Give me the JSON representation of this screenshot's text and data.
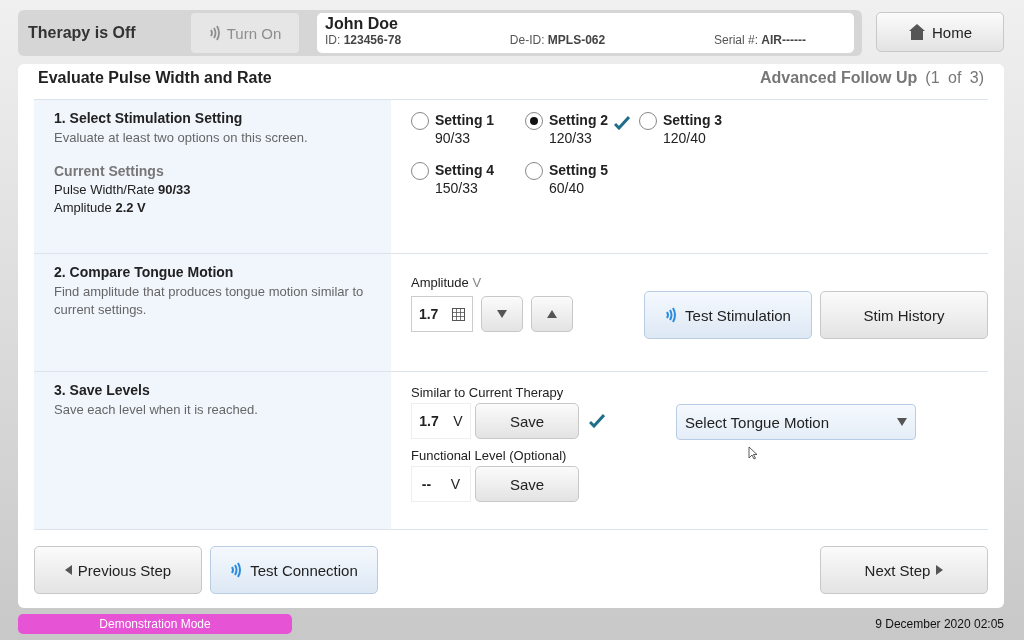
{
  "header": {
    "therapy_status": "Therapy is Off",
    "turn_on": {
      "label": "Turn On",
      "disabled": true
    },
    "patient": {
      "name": "John Doe",
      "id_label": "ID:",
      "id": "123456-78",
      "deid_label": "De-ID:",
      "deid": "MPLS-062",
      "serial_label": "Serial #:",
      "serial": "AIR------"
    },
    "home": "Home"
  },
  "panel": {
    "title": "Evaluate Pulse Width and Rate",
    "subtitle": "Advanced Follow Up",
    "step": "(1 of 3)"
  },
  "section_1": {
    "title": "1. Select Stimulation Setting",
    "hint": "Evaluate at least two options on this screen.",
    "current_heading": "Current Settings",
    "current": [
      {
        "label": "Pulse Width/Rate",
        "value": "90/33"
      },
      {
        "label": "Amplitude",
        "value": "2.2 V"
      }
    ],
    "settings": [
      {
        "label": "Setting 1",
        "value": "90/33",
        "selected": false,
        "evaluated": false
      },
      {
        "label": "Setting 2",
        "value": "120/33",
        "selected": true,
        "evaluated": true
      },
      {
        "label": "Setting 3",
        "value": "120/40",
        "selected": false,
        "evaluated": false
      },
      {
        "label": "Setting 4",
        "value": "150/33",
        "selected": false,
        "evaluated": false
      },
      {
        "label": "Setting 5",
        "value": "60/40",
        "selected": false,
        "evaluated": false
      }
    ]
  },
  "section_2": {
    "title": "2. Compare Tongue Motion",
    "hint": "Find amplitude that produces tongue motion similar to current settings.",
    "amplitude_label": "Amplitude",
    "amplitude_unit": "V",
    "amplitude_value": "1.7",
    "test_button": "Test Stimulation",
    "history_button": "Stim History"
  },
  "section_3": {
    "title": "3. Save Levels",
    "hint": "Save each level when it is reached.",
    "levels": [
      {
        "label": "Similar to Current Therapy",
        "value": "1.7",
        "unit": "V",
        "button": "Save",
        "saved": true
      },
      {
        "label": "Functional Level (Optional)",
        "value": "--",
        "unit": "V",
        "button": "Save",
        "saved": false
      }
    ],
    "dropdown": "Select Tongue Motion"
  },
  "footer": {
    "previous": "Previous Step",
    "test_connection": "Test Connection",
    "next": "Next Step"
  },
  "status_bar": {
    "mode": "Demonstration Mode",
    "datetime": "9 December 2020 02:05"
  }
}
